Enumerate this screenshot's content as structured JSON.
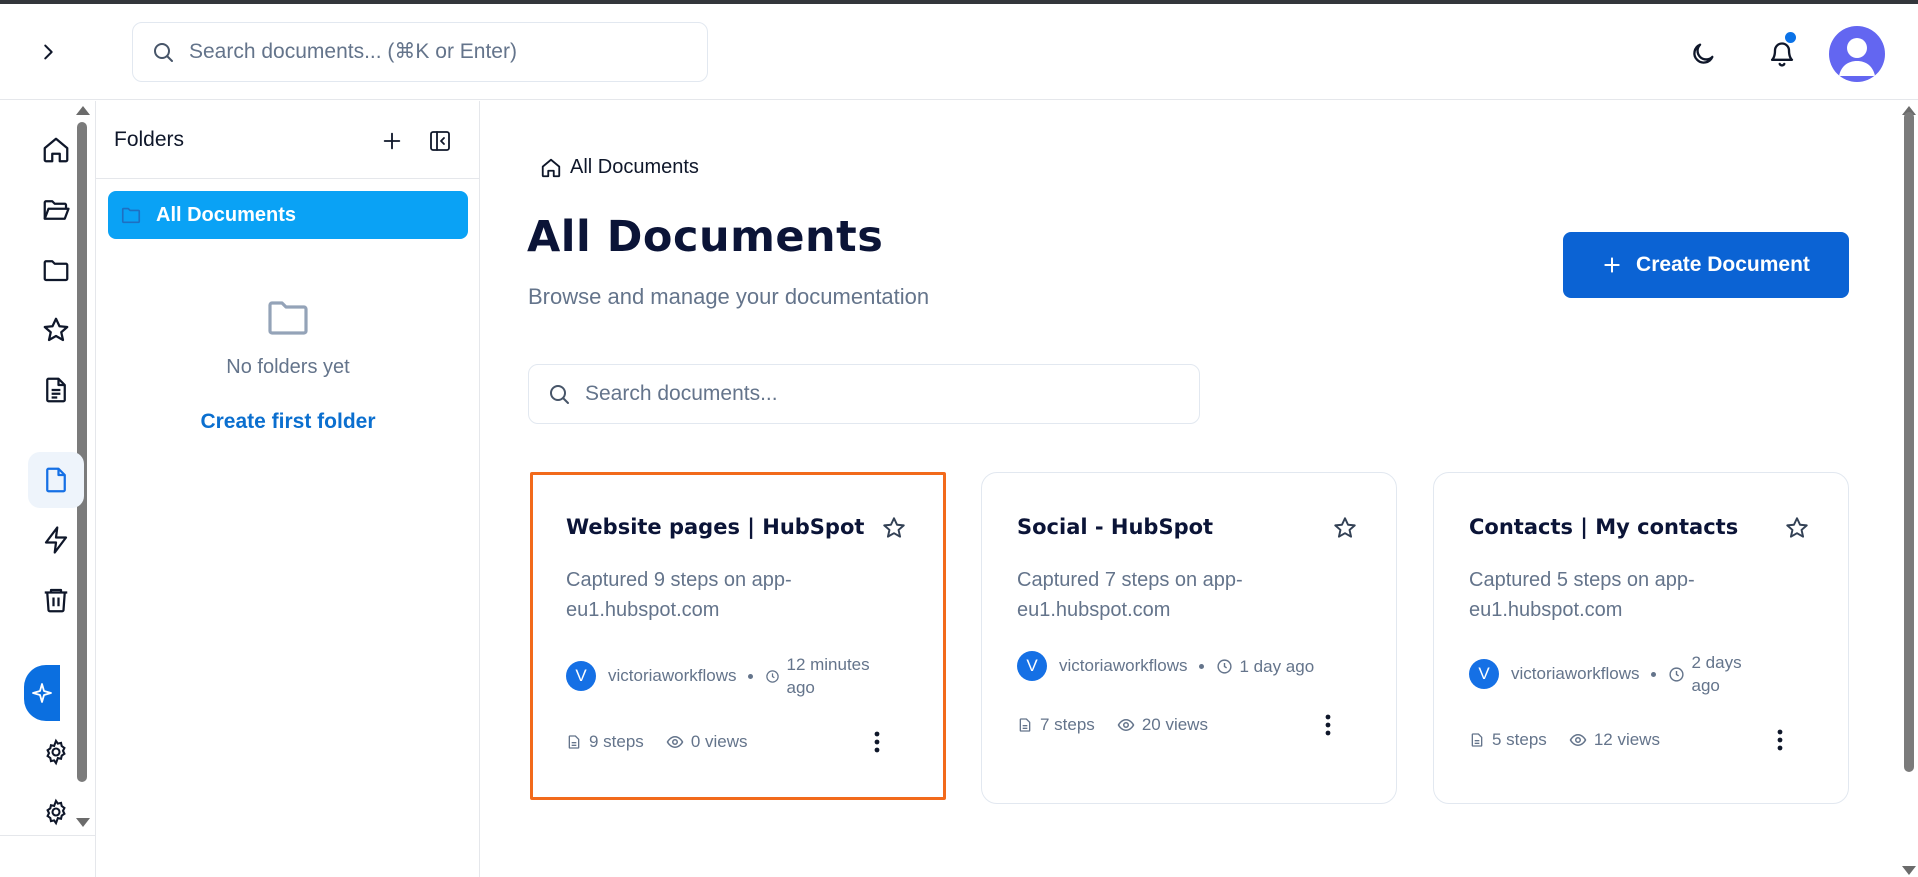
{
  "header": {
    "search_placeholder": "Search documents... (⌘K or Enter)"
  },
  "colors": {
    "primary": "#0b63d4",
    "folder_active": "#0aa2f5",
    "highlight_border": "#f26a1b",
    "avatar": "#6366f1"
  },
  "rail": {
    "icons": [
      "home-icon",
      "folder-open-icon",
      "folder-icon",
      "star-icon",
      "file-text-icon",
      "file-icon",
      "zap-icon",
      "trash-icon",
      "sparkle-icon",
      "settings-icon",
      "settings-icon"
    ]
  },
  "folders": {
    "title": "Folders",
    "all_documents": "All Documents",
    "empty_text": "No folders yet",
    "create_first": "Create first folder"
  },
  "main": {
    "breadcrumb": "All Documents",
    "title": "All Documents",
    "subtitle": "Browse and manage your documentation",
    "create_button": "Create Document",
    "search_placeholder": "Search documents..."
  },
  "documents": [
    {
      "title": "Website pages | HubSpot",
      "description": "Captured 9 steps on app-eu1.hubspot.com",
      "avatar_letter": "V",
      "user": "victoriaworkflows",
      "time": "12 minutes ago",
      "steps": "9 steps",
      "views": "0 views"
    },
    {
      "title": "Social - HubSpot",
      "description": "Captured 7 steps on app-eu1.hubspot.com",
      "avatar_letter": "V",
      "user": "victoriaworkflows",
      "time": "1 day ago",
      "steps": "7 steps",
      "views": "20 views"
    },
    {
      "title": "Contacts | My contacts",
      "description": "Captured 5 steps on app-eu1.hubspot.com",
      "avatar_letter": "V",
      "user": "victoriaworkflows",
      "time": "2 days ago",
      "steps": "5 steps",
      "views": "12 views"
    }
  ]
}
